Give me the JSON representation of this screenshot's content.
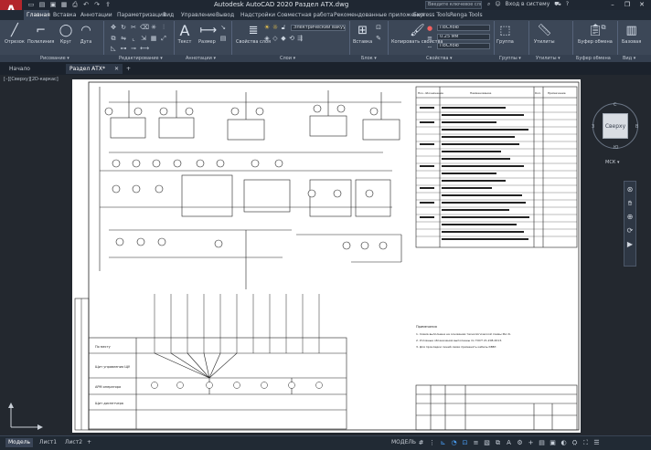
{
  "app": {
    "title": "Autodesk AutoCAD 2020   Раздел АТХ.dwg",
    "search_placeholder": "Введите ключевое слово/фразу",
    "sign_in": "Вход в систему",
    "window_controls": [
      "–",
      "❐",
      "✕"
    ]
  },
  "ribbon_tabs": [
    {
      "label": "Главная",
      "active": true
    },
    {
      "label": "Вставка"
    },
    {
      "label": "Аннотации"
    },
    {
      "label": "Параметризация"
    },
    {
      "label": "Вид"
    },
    {
      "label": "Управление"
    },
    {
      "label": "Вывод"
    },
    {
      "label": "Надстройки"
    },
    {
      "label": "Совместная работа"
    },
    {
      "label": "Рекомендованные приложения"
    },
    {
      "label": "Express Tools"
    },
    {
      "label": "Renga Tools"
    }
  ],
  "ribbon": {
    "draw": [
      "Отрезок",
      "Полилиния",
      "Круг",
      "Дуга"
    ],
    "annotation": [
      "Текст",
      "Размер"
    ],
    "layer_props": "Свойства слоя",
    "layer_current": "Электрический вакуумный",
    "block": "Вставка",
    "match_props": "Копировать свойства",
    "color": "ПоСлою",
    "lineweight": "0.25 мм",
    "linetype": "ПоСлою",
    "groups": "Группа",
    "utilities": "Утилиты",
    "clipboard": "Буфер обмена",
    "base": "Базовая",
    "view": "Вид"
  },
  "panel_titles": {
    "draw": "Рисование ▾",
    "modify": "Редактирование ▾",
    "annotation": "Аннотации ▾",
    "layers": "Слои ▾",
    "block": "Блок ▾",
    "properties": "Свойства ▾",
    "groups": "Группы ▾",
    "utilities": "Утилиты ▾",
    "clipboard": "Буфер обмена",
    "view": "Вид ▾"
  },
  "doc_tabs": [
    {
      "label": "Начало"
    },
    {
      "label": "Раздел АТХ*",
      "active": true
    }
  ],
  "viewport_label": "[–][Сверху][2D-каркас]",
  "viewcube": {
    "face": "Сверху",
    "north": "С",
    "south": "Ю",
    "west": "З",
    "east": "В",
    "wcs": "МСК ▾"
  },
  "status": {
    "tabs": [
      {
        "label": "Модель",
        "active": true
      },
      {
        "label": "Лист1"
      },
      {
        "label": "Лист2"
      }
    ],
    "model_label": "МОДЕЛЬ"
  },
  "drawing": {
    "table_headers": [
      "Поз. обозначение",
      "Наименование",
      "Кол.",
      "Примечание"
    ],
    "notes_title": "Примечания",
    "notes": [
      "1. Схема выполнена на основании технологической схемы Рис.6.",
      "2. Условные обозначения выполнены по ГОСТ 21.208-2013.",
      "3. Для прокладки линий связи применять кабель КВВГ."
    ],
    "row_labels": [
      "По месту",
      "Щит управления ЩУ",
      "АРМ оператора",
      "Щит диспетчера"
    ]
  },
  "colors": {
    "ribbon_bg": "#3c4757",
    "titlebar_bg": "#1f2732",
    "canvas_bg": "#23282f",
    "sheet_bg": "#ffffff",
    "accent_logo": "#b3262c"
  }
}
